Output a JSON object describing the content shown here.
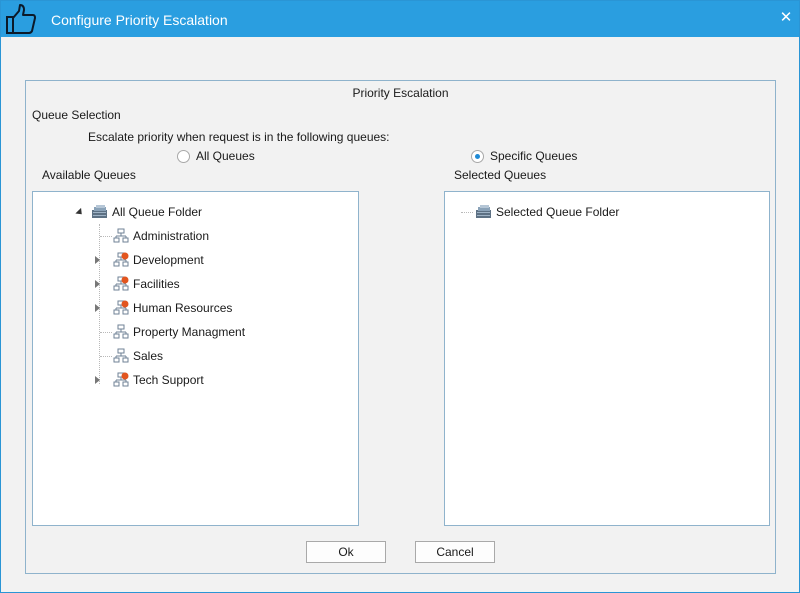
{
  "window": {
    "title": "Configure Priority Escalation",
    "close_glyph": "✕",
    "icon": "thumbs-up-icon"
  },
  "group": {
    "title": "Priority Escalation",
    "queue_selection_label": "Queue Selection",
    "escalate_text": "Escalate priority when request is in the following queues:",
    "radio_all": {
      "label": "All Queues",
      "checked": false
    },
    "radio_specific": {
      "label": "Specific Queues",
      "checked": true
    }
  },
  "available": {
    "label": "Available Queues",
    "root": {
      "label": "All Queue Folder",
      "expanded": true,
      "icon": "queue-folder-icon"
    },
    "items": [
      {
        "label": "Administration",
        "has_children": false,
        "icon": "queue-icon"
      },
      {
        "label": "Development",
        "has_children": true,
        "icon": "queue-restricted-icon"
      },
      {
        "label": "Facilities",
        "has_children": true,
        "icon": "queue-restricted-icon"
      },
      {
        "label": "Human Resources",
        "has_children": true,
        "icon": "queue-restricted-icon"
      },
      {
        "label": "Property Managment",
        "has_children": false,
        "icon": "queue-icon"
      },
      {
        "label": "Sales",
        "has_children": false,
        "icon": "queue-icon"
      },
      {
        "label": "Tech Support",
        "has_children": true,
        "icon": "queue-restricted-icon"
      }
    ]
  },
  "selected": {
    "label": "Selected Queues",
    "root": {
      "label": "Selected Queue Folder",
      "icon": "queue-folder-icon"
    }
  },
  "buttons": {
    "ok": "Ok",
    "cancel": "Cancel"
  },
  "colors": {
    "titlebar": "#2a9ee0",
    "border": "#8fb3cc",
    "radio_accent": "#1f8ad6",
    "restricted_badge": "#e2551f"
  }
}
